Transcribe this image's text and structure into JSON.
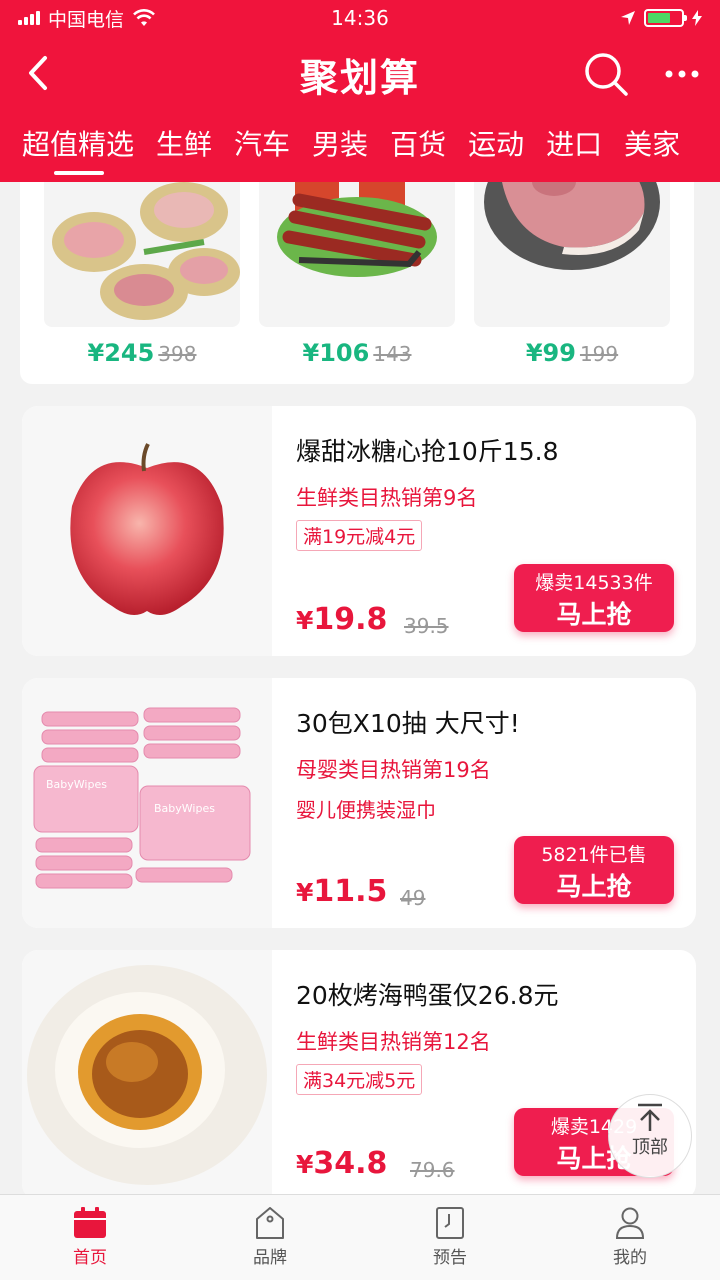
{
  "status": {
    "carrier": "中国电信",
    "time": "14:36"
  },
  "nav": {
    "title": "聚划算"
  },
  "tabs": [
    "超值精选",
    "生鲜",
    "汽车",
    "男装",
    "百货",
    "运动",
    "进口",
    "美家"
  ],
  "top_products": [
    {
      "price": "¥245",
      "original": "398"
    },
    {
      "price": "¥106",
      "original": "143"
    },
    {
      "price": "¥99",
      "original": "199"
    }
  ],
  "products": [
    {
      "title": "爆甜冰糖心抢10斤15.8",
      "rank": "生鲜类目热销第9名",
      "promo": "满19元减4元",
      "price": "19.8",
      "original": "39.5",
      "sold": "爆卖14533件",
      "cta": "马上抢"
    },
    {
      "title": "30包X10抽  大尺寸!",
      "rank": "母婴类目热销第19名",
      "subtitle": "婴儿便携装湿巾",
      "price": "11.5",
      "original": "49",
      "sold": "5821件已售",
      "cta": "马上抢"
    },
    {
      "title": "20枚烤海鸭蛋仅26.8元",
      "rank": "生鲜类目热销第12名",
      "promo": "满34元减5元",
      "price": "34.8",
      "original": "79.6",
      "sold": "爆卖1429",
      "cta": "马上抢"
    }
  ],
  "wipes_label": "BabyWipes",
  "top_button": {
    "label": "顶部"
  },
  "tabbar": [
    {
      "label": "首页",
      "icon": "calendar-icon"
    },
    {
      "label": "品牌",
      "icon": "tag-icon"
    },
    {
      "label": "预告",
      "icon": "bookmark-icon"
    },
    {
      "label": "我的",
      "icon": "user-icon"
    }
  ],
  "colors": {
    "brand": "#f0143c",
    "price_green": "#19b680",
    "price_red": "#e8163c",
    "battery": "#4cd964"
  }
}
